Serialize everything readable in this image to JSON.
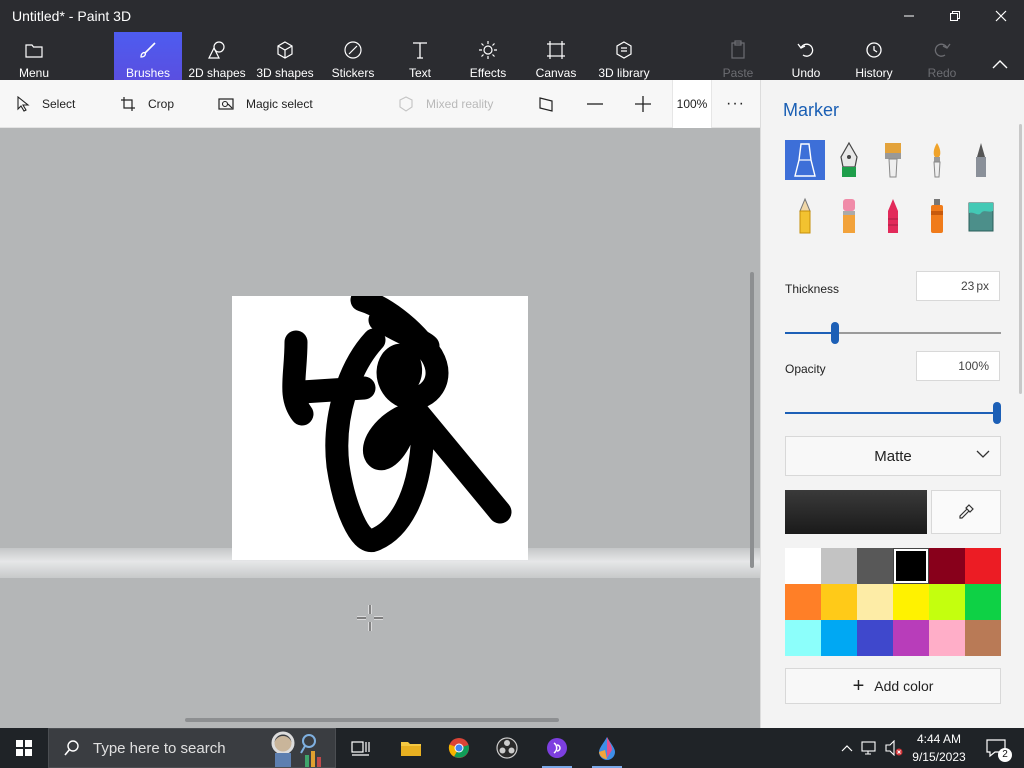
{
  "window": {
    "title": "Untitled* - Paint 3D"
  },
  "ribbon": {
    "menu": "Menu",
    "brushes": "Brushes",
    "shapes2d": "2D shapes",
    "shapes3d": "3D shapes",
    "stickers": "Stickers",
    "text": "Text",
    "effects": "Effects",
    "canvas": "Canvas",
    "library3d": "3D library",
    "paste": "Paste",
    "undo": "Undo",
    "history": "History",
    "redo": "Redo",
    "active_tab": "Brushes"
  },
  "toolbar": {
    "select": "Select",
    "crop": "Crop",
    "magic_select": "Magic select",
    "mixed_reality": "Mixed reality",
    "zoom": "100%"
  },
  "panel": {
    "title": "Marker",
    "brushes": [
      "marker-icon",
      "calligraphy-pen-icon",
      "oil-brush-icon",
      "watercolor-icon",
      "pixel-pen-icon",
      "pencil-icon",
      "eraser-icon",
      "crayon-icon",
      "spray-can-icon",
      "fill-icon"
    ],
    "selected_brush": "marker",
    "thickness_label": "Thickness",
    "thickness_value": "23",
    "thickness_unit": "px",
    "thickness_level": 0.23,
    "opacity_label": "Opacity",
    "opacity_value": "100%",
    "opacity_level": 1.0,
    "finish": "Matte",
    "current_color": "#1a1a1a",
    "add_color": "Add color",
    "palette": [
      "#ffffff",
      "#c3c3c3",
      "#585858",
      "#000000",
      "#88001b",
      "#ec1c24",
      "#ff7f27",
      "#ffca18",
      "#fdeca6",
      "#fff200",
      "#c4ff0e",
      "#0ed145",
      "#8cfffb",
      "#00a8f3",
      "#3f48cc",
      "#b83dba",
      "#ffaec8",
      "#b97a56"
    ],
    "selected_swatch": 3
  },
  "taskbar": {
    "search_placeholder": "Type here to search",
    "time": "4:44 AM",
    "date": "9/15/2023",
    "notifications": "2"
  }
}
